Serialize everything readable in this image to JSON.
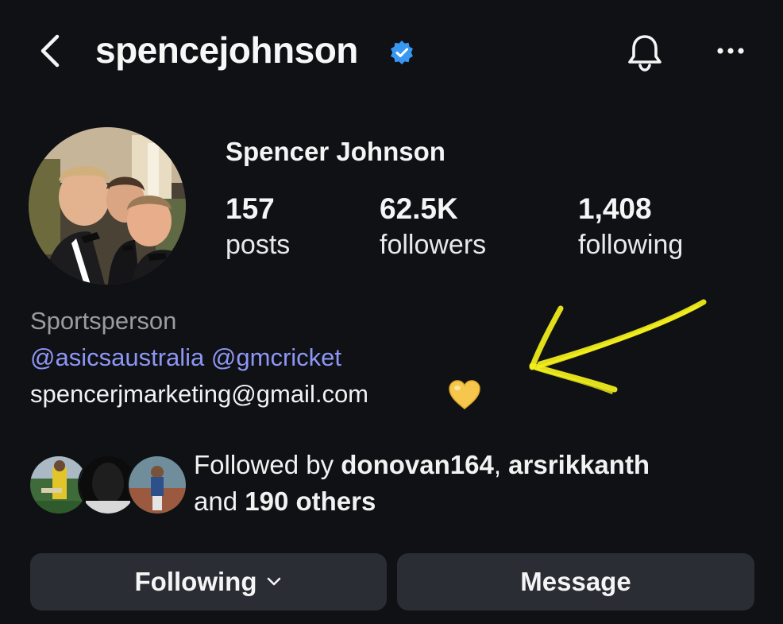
{
  "header": {
    "username": "spencejohnson",
    "back_icon": "chevron-left-icon",
    "verified_icon": "verified-badge-icon",
    "bell_icon": "bell-icon",
    "more_icon": "more-horizontal-icon",
    "verified_color": "#3897f0"
  },
  "profile": {
    "display_name": "Spencer Johnson",
    "stats": [
      {
        "value": "157",
        "label": "posts"
      },
      {
        "value": "62.5K",
        "label": "followers"
      },
      {
        "value": "1,408",
        "label": "following"
      }
    ],
    "category": "Sportsperson",
    "mentions": [
      "@asicsaustralia",
      "@gmcricket"
    ],
    "email": "spencerjmarketing@gmail.com",
    "emoji_icon": "yellow-heart-icon",
    "mention_color": "#8e96f5"
  },
  "annotation": {
    "arrow_color": "#f3f01d"
  },
  "followed_by": {
    "prefix": "Followed by ",
    "user1": "donovan164",
    "separator": ", ",
    "user2": "arsrikkanth",
    "middle": "and ",
    "others": "190 others"
  },
  "actions": {
    "following_label": "Following",
    "message_label": "Message"
  }
}
